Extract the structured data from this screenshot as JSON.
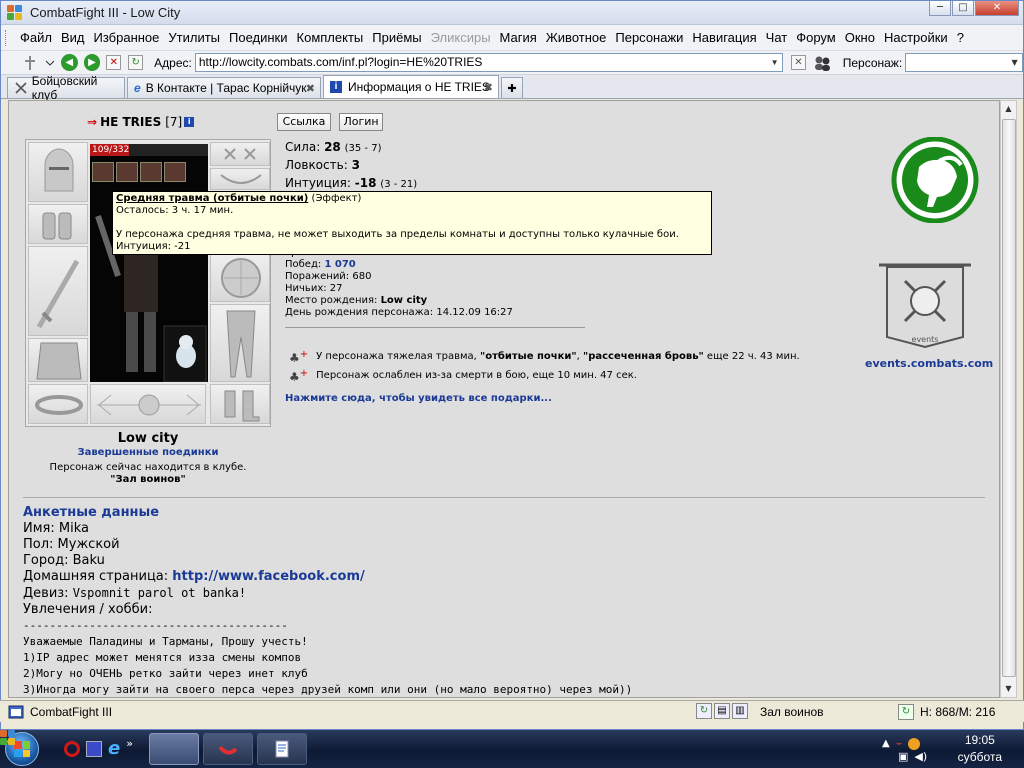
{
  "window": {
    "title": "CombatFight III - Low City",
    "minimize": "─",
    "maximize": "□",
    "close": "✕"
  },
  "menu": [
    "Файл",
    "Вид",
    "Избранное",
    "Утилиты",
    "Поединки",
    "Комплекты",
    "Приёмы",
    "Эликсиры",
    "Магия",
    "Животное",
    "Персонажи",
    "Навигация",
    "Чат",
    "Форум",
    "Окно",
    "Настройки",
    "?"
  ],
  "menu_disabled": [
    "Эликсиры"
  ],
  "toolbar": {
    "address_label": "Адрес:",
    "address_value": "http://lowcity.combats.com/inf.pl?login=HE%20TRIES",
    "person_label": "Персонаж:",
    "person_value": ""
  },
  "tabs": [
    {
      "label": "Бойцовский клуб",
      "active": false
    },
    {
      "label": "В Контакте | Тарас Корнійчук",
      "active": false
    },
    {
      "label": "Информация о HE TRIES",
      "active": true
    }
  ],
  "char": {
    "name": "HE TRIES",
    "level_bracket": "[7]",
    "hp": "109/332",
    "link_button": "Ссылка",
    "login_button": "Логин",
    "location_city": "Low city",
    "finished_fights": "Завершенные поединки",
    "in_club_text": "Персонаж сейчас находится в клубе.",
    "room": "\"Зал воинов\""
  },
  "stats": [
    {
      "label": "Сила:",
      "value": "28",
      "extra": "(35 - 7)"
    },
    {
      "label": "Ловкость:",
      "value": "3",
      "extra": ""
    },
    {
      "label": "Интуиция:",
      "value": "-18",
      "extra": "(3 - 21)"
    }
  ],
  "tooltip": {
    "title": "Средняя травма (отбитые почки)",
    "title_suffix": "(Эффект)",
    "remaining": "Осталось: 3 ч. 17 мин.",
    "description": "У персонажа средняя травма, не может выходить за пределы комнаты и доступны только кулачные бои.",
    "effect": "Интуиция: -21"
  },
  "info": {
    "level_partial": "Уровень: 7",
    "wins_label": "Побед:",
    "wins": "1 070",
    "losses": "Поражений: 680",
    "draws": "Ничьих: 27",
    "birthplace_label": "Место рождения:",
    "birthplace": "Low city",
    "birthday": "День рождения персонажа: 14.12.09 16:27"
  },
  "effects": [
    {
      "pre": "У персонажа тяжелая травма, ",
      "b1": "\"отбитые почки\"",
      "mid": ", ",
      "b2": "\"рассеченная бровь\"",
      "post": " еще 22 ч. 43 мин."
    },
    {
      "pre": "Персонаж ослаблен из-за смерти в бою, еще 10 мин. 47 сек."
    }
  ],
  "gifts_link": "Нажмите сюда, чтобы увидеть все подарки...",
  "events_link": "events.combats.com",
  "events_banner_text": "events",
  "profile": {
    "header": "Анкетные данные",
    "name": "Имя: Mika",
    "sex": "Пол: Мужской",
    "city": "Город: Baku",
    "homepage_label": "Домашняя страница:",
    "homepage": "http://www.facebook.com/",
    "motto_label": "Девиз:",
    "motto": "Vspomnit parol ot banka!",
    "hobby": "Увлечения / хобби:",
    "lines": [
      "----------------------------------------",
      "Уважаемые Паладины и Тарманы, Прошу учесть!",
      "1)IP адрес может менятся изза смены компов",
      "2)Могу но ОЧЕНЬ ретко зайти через инет клуб",
      "3)Иногда могу зайти на своего перса через друзей комп или они (но мало вероятно) через мой))"
    ]
  },
  "status": {
    "app": "CombatFight III",
    "room": "Зал воинов",
    "hp_mana": "H: 868/M: 216"
  },
  "taskbar": {
    "time": "19:05",
    "day": "суббота",
    "chevron": "»"
  },
  "colors": {
    "accent_link": "#1b3a96",
    "logo_green": "#1a8a1a",
    "content_bg": "#dedede"
  }
}
